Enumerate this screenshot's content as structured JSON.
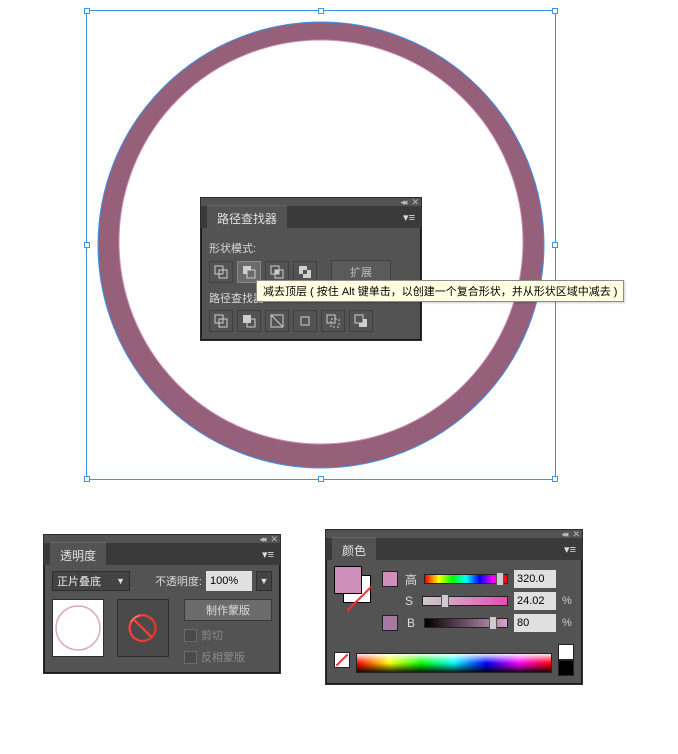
{
  "pathfinder": {
    "title": "路径查找器",
    "shape_modes_label": "形状模式:",
    "expand": "扩展",
    "pathfinders_label": "路径查找器:"
  },
  "tooltip": "减去顶层 ( 按住 Alt 键单击，以创建一个复合形状，并从形状区域中减去 )",
  "transparency": {
    "title": "透明度",
    "blend_mode": "正片叠底",
    "opacity_label": "不透明度:",
    "opacity_value": "100%",
    "make_mask": "制作蒙版",
    "clip": "剪切",
    "invert": "反相蒙版"
  },
  "color": {
    "title": "颜色",
    "h_label": "高",
    "s_label": "S",
    "b_label": "B",
    "h_value": "320.0",
    "s_value": "24.02",
    "b_value": "80",
    "h_unit": "",
    "s_unit": "%",
    "b_unit": "%",
    "h_swatch": "#cf8fbc",
    "b_swatch": "#a779a1"
  }
}
